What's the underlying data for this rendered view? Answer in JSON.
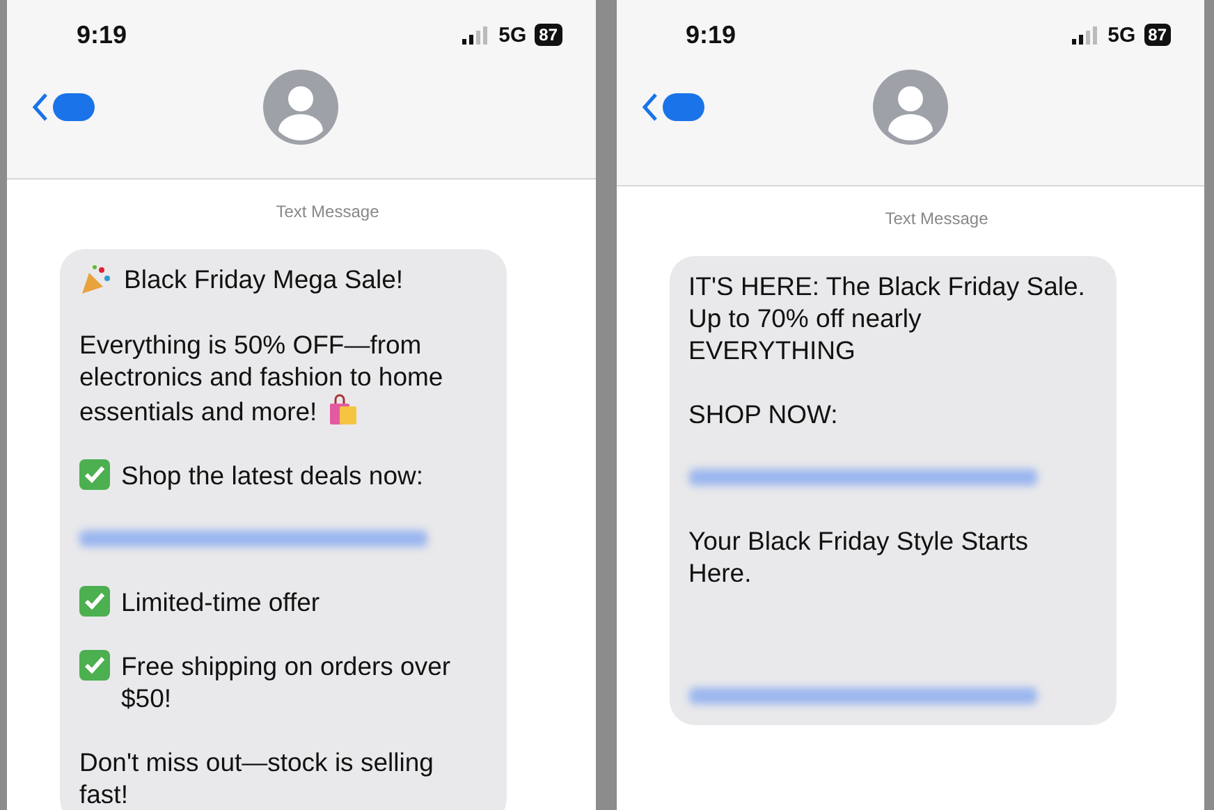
{
  "phones": [
    {
      "status": {
        "time": "9:19",
        "network": "5G",
        "battery": "87"
      },
      "label": "Text Message",
      "paragraphs": [
        {
          "kind": "party",
          "text": "Black Friday Mega Sale!"
        },
        {
          "kind": "bag",
          "text": "Everything is 50% OFF—from electronics and fashion to home essentials and more!"
        },
        {
          "kind": "check",
          "text": "Shop the latest deals now:"
        },
        {
          "kind": "link"
        },
        {
          "kind": "check",
          "text": "Limited-time offer"
        },
        {
          "kind": "check",
          "text": "Free shipping on orders over $50!"
        },
        {
          "kind": "plain",
          "text": "Don't miss out—stock is selling fast!"
        }
      ]
    },
    {
      "status": {
        "time": "9:19",
        "network": "5G",
        "battery": "87"
      },
      "label": "Text Message",
      "paragraphs": [
        {
          "kind": "plain",
          "text": "IT'S HERE: The Black Friday Sale. Up to 70% off nearly EVERYTHING"
        },
        {
          "kind": "plain",
          "text": "SHOP NOW:"
        },
        {
          "kind": "link"
        },
        {
          "kind": "plain",
          "text": "Your Black Friday Style Starts Here."
        },
        {
          "kind": "spacer"
        },
        {
          "kind": "link"
        }
      ]
    }
  ]
}
